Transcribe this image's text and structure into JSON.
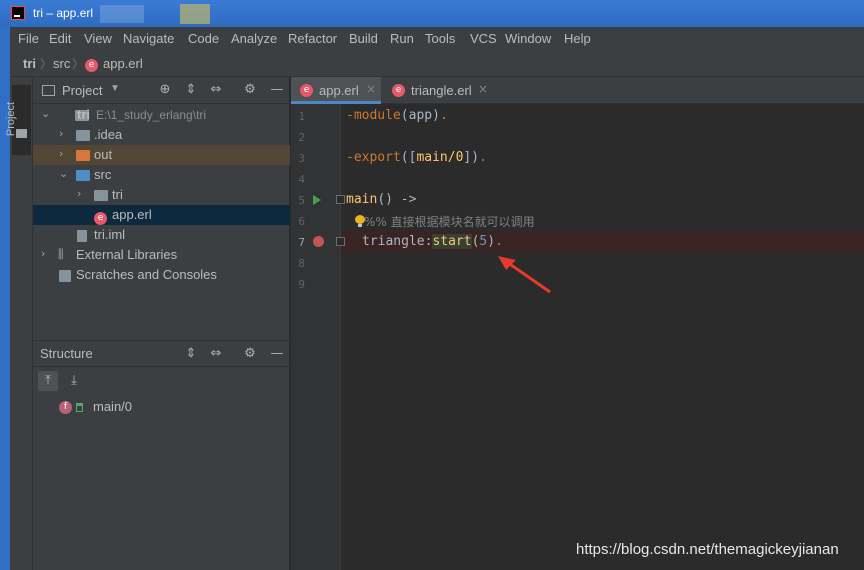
{
  "window": {
    "title": "tri – app.erl"
  },
  "menu": [
    "File",
    "Edit",
    "View",
    "Navigate",
    "Code",
    "Analyze",
    "Refactor",
    "Build",
    "Run",
    "Tools",
    "VCS",
    "Window",
    "Help"
  ],
  "breadcrumb": {
    "project": "tri",
    "folder": "src",
    "file": "app.erl"
  },
  "stripe": {
    "project_tab": "Project"
  },
  "project_panel": {
    "title": "Project",
    "tree": [
      {
        "label": "tri",
        "detail": "E:\\1_study_erlang\\tri"
      },
      {
        "label": ".idea"
      },
      {
        "label": "out"
      },
      {
        "label": "src"
      },
      {
        "label": "tri"
      },
      {
        "label": "app.erl"
      },
      {
        "label": "tri.iml"
      },
      {
        "label": "External Libraries"
      },
      {
        "label": "Scratches and Consoles"
      }
    ]
  },
  "structure_panel": {
    "title": "Structure",
    "items": [
      {
        "label": "main/0",
        "icon": "f"
      }
    ]
  },
  "editor": {
    "tabs": [
      {
        "label": "app.erl",
        "active": true
      },
      {
        "label": "triangle.erl",
        "active": false
      }
    ],
    "line_numbers": [
      "1",
      "2",
      "3",
      "4",
      "5",
      "6",
      "7",
      "8",
      "9"
    ],
    "lines": {
      "l1_attr": "-module",
      "l1_arg": "app",
      "l3_attr": "-export",
      "l3_arg": "main/0",
      "l5_fn": "main",
      "l5_rest": "() ->",
      "l6_comment": "%% 直接根据模块名就可以调用",
      "l7_mod": "triangle",
      "l7_fn": "start",
      "l7_num": "5"
    }
  },
  "watermark": "https://blog.csdn.net/themagickeyjianan",
  "colors": {
    "accent": "#4a88c7",
    "breakpoint": "#c75450",
    "erl_icon": "#e8586b",
    "annotation_arrow": "#e8392a"
  }
}
